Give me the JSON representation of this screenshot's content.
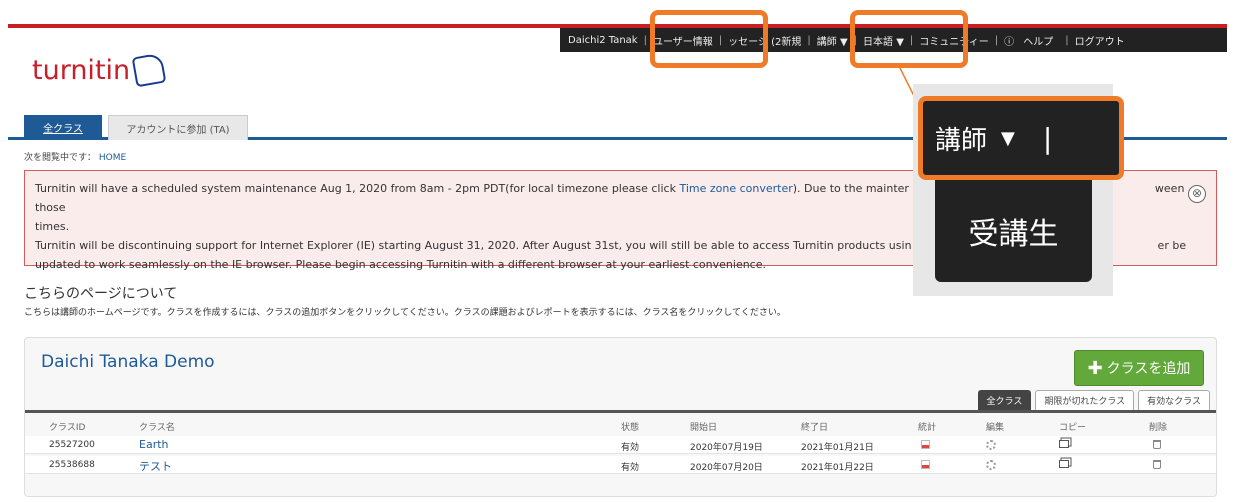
{
  "topbar": {
    "user": "Daichi2 Tanak",
    "user_info": "ユーザー情報",
    "messages": "ッセージ (2新規",
    "role": "講師 ▼",
    "language": "日本語 ▼",
    "community": "コミュニティー",
    "help": "ヘルプ",
    "logout": "ログアウト",
    "separator": "|"
  },
  "logo": {
    "text": "turnitin"
  },
  "tabs": {
    "all_classes": "全クラス",
    "join_account": "アカウントに参加 (TA)"
  },
  "breadcrumb": {
    "prefix": "次を閲覧中です：",
    "home": "HOME"
  },
  "alert": {
    "line1_a": "Turnitin will have a scheduled system maintenance Aug 1, 2020 from 8am - 2pm PDT(for local timezone please click ",
    "line1_link": "Time zone converter",
    "line1_b": "). Due to the mainter",
    "line1_c": "ween those",
    "line2": "times.",
    "line3_a": "Turnitin will be discontinuing support for Internet Explorer (IE) starting August 31, 2020. After August 31st, you will still be able to access Turnitin products usin",
    "line3_b": "er be",
    "line4": "updated to work seamlessly on the IE browser. Please begin accessing Turnitin with a different browser at your earliest convenience.",
    "close_icon": "⊗"
  },
  "about": {
    "title": "こちらのページについて",
    "text": "こちらは講師のホームページです。クラスを作成するには、クラスの追加ボタンをクリックしてください。クラスの課題およびレポートを表示するには、クラス名をクリックしてください。"
  },
  "class_box": {
    "title": "Daichi Tanaka Demo",
    "add_button": "クラスを追加",
    "filters": [
      "全クラス",
      "期限が切れたクラス",
      "有効なクラス"
    ],
    "columns": {
      "id": "クラスID",
      "name": "クラス名",
      "status": "状態",
      "start": "開始日",
      "end": "終了日",
      "stats": "統計",
      "edit": "編集",
      "copy": "コピー",
      "delete": "削除"
    },
    "rows": [
      {
        "id": "25527200",
        "name": "Earth",
        "status": "有効",
        "start": "2020年07月19日",
        "end": "2021年01月21日"
      },
      {
        "id": "25538688",
        "name": "テスト",
        "status": "有効",
        "start": "2020年07月20日",
        "end": "2021年01月22日"
      }
    ]
  },
  "zoom": {
    "role": "講師",
    "triangle": "▼",
    "bar": "|",
    "option": "受講生"
  },
  "colors": {
    "brand_red": "#c8202a",
    "link_blue": "#1e5a96",
    "highlight_orange": "#ef7b28",
    "add_green": "#63a83b"
  }
}
